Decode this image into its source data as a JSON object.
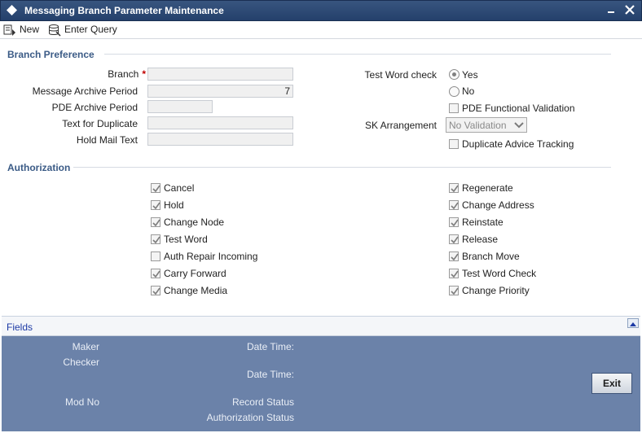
{
  "window": {
    "title": "Messaging Branch Parameter Maintenance"
  },
  "toolbar": {
    "new_label": "New",
    "enter_query_label": "Enter Query"
  },
  "branch_preference": {
    "section_title": "Branch Preference",
    "branch_label": "Branch",
    "required_mark": "*",
    "branch_value": "",
    "message_archive_period_label": "Message Archive Period",
    "message_archive_period_value": "7",
    "pde_archive_period_label": "PDE Archive Period",
    "pde_archive_period_value": "",
    "text_for_duplicate_label": "Text for Duplicate",
    "text_for_duplicate_value": "",
    "hold_mail_text_label": "Hold Mail Text",
    "hold_mail_text_value": "",
    "test_word_check_label": "Test Word check",
    "test_word_yes": "Yes",
    "test_word_no": "No",
    "test_word_selected": "Yes",
    "pde_functional_validation_label": "PDE Functional Validation",
    "pde_functional_validation_checked": false,
    "sk_arrangement_label": "SK Arrangement",
    "sk_arrangement_value": "No Validation",
    "duplicate_advice_tracking_label": "Duplicate Advice Tracking",
    "duplicate_advice_tracking_checked": false
  },
  "authorization": {
    "section_title": "Authorization",
    "left": [
      {
        "label": "Cancel",
        "checked": true
      },
      {
        "label": "Hold",
        "checked": true
      },
      {
        "label": "Change Node",
        "checked": true
      },
      {
        "label": "Test Word",
        "checked": true
      },
      {
        "label": "Auth Repair Incoming",
        "checked": false
      },
      {
        "label": "Carry Forward",
        "checked": true
      },
      {
        "label": "Change Media",
        "checked": true
      }
    ],
    "right": [
      {
        "label": "Regenerate",
        "checked": true
      },
      {
        "label": "Change Address",
        "checked": true
      },
      {
        "label": "Reinstate",
        "checked": true
      },
      {
        "label": "Release",
        "checked": true
      },
      {
        "label": "Branch Move",
        "checked": true
      },
      {
        "label": "Test Word Check",
        "checked": true
      },
      {
        "label": "Change Priority",
        "checked": true
      }
    ]
  },
  "fields_bar": {
    "label": "Fields"
  },
  "audit": {
    "maker_label": "Maker",
    "checker_label": "Checker",
    "date_time_label_1": "Date Time:",
    "date_time_label_2": "Date Time:",
    "mod_no_label": "Mod No",
    "record_status_label": "Record Status",
    "authorization_status_label": "Authorization Status",
    "exit_label": "Exit"
  },
  "colors": {
    "title_bar": "#2e4a76",
    "section_title": "#3b5b86",
    "audit_background": "#6b82a9",
    "fields_link": "#1d3aa5"
  }
}
